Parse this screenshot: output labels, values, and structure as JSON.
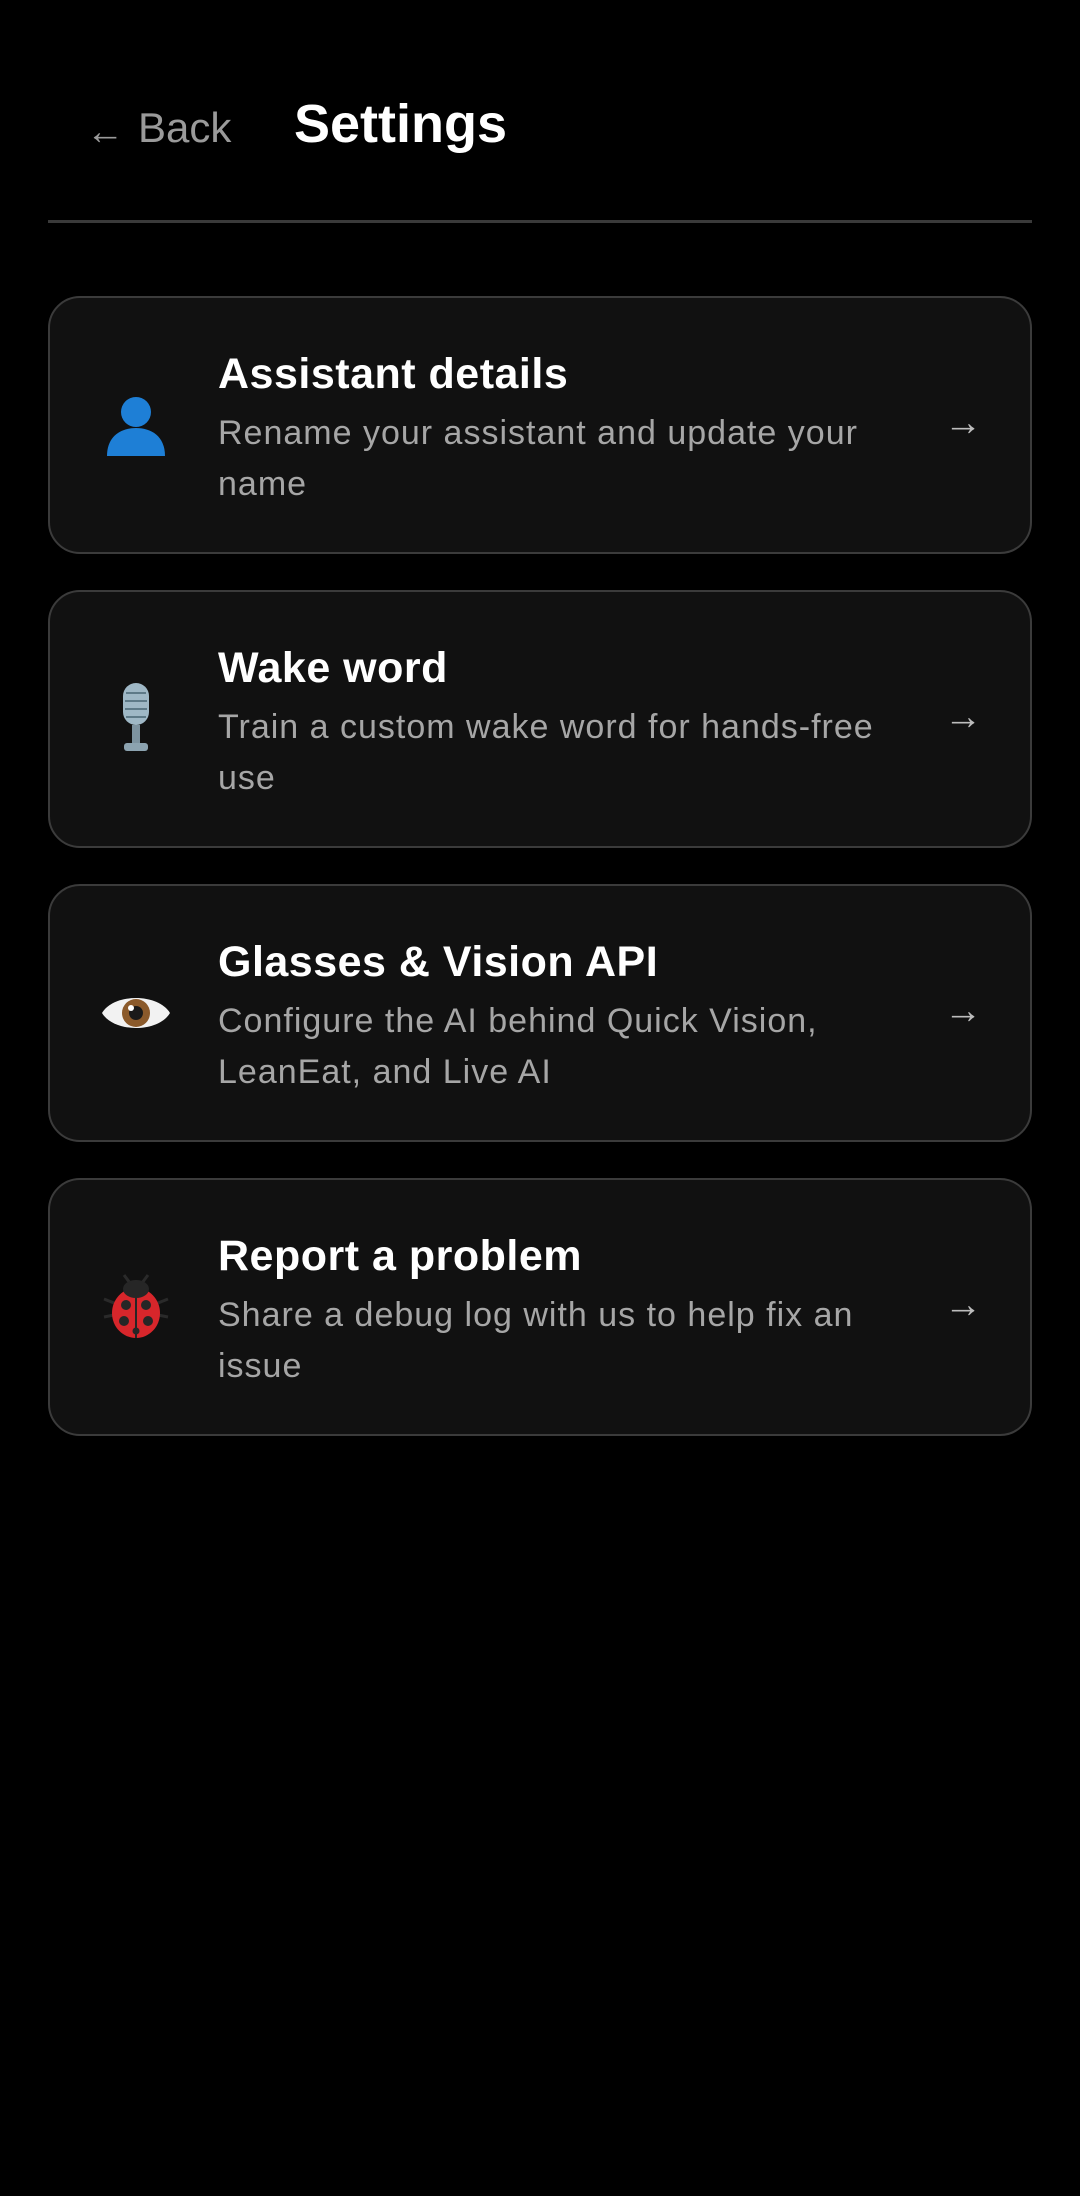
{
  "header": {
    "back_arrow": "←",
    "back_label": "Back",
    "title": "Settings"
  },
  "cards": [
    {
      "icon": "person-icon",
      "title": "Assistant details",
      "description": "Rename your assistant and update your name",
      "arrow": "→"
    },
    {
      "icon": "microphone-icon",
      "title": "Wake word",
      "description": "Train a custom wake word for hands-free use",
      "arrow": "→"
    },
    {
      "icon": "eye-icon",
      "title": "Glasses & Vision API",
      "description": "Configure the AI behind Quick Vision, LeanEat, and Live AI",
      "arrow": "→"
    },
    {
      "icon": "ladybug-icon",
      "title": "Report a problem",
      "description": "Share a debug log with us to help fix an issue",
      "arrow": "→"
    }
  ],
  "colors": {
    "background": "#000000",
    "card_background": "#111111",
    "card_border": "#3b3b3b",
    "title_text": "#ffffff",
    "secondary_text": "#a6a6a6",
    "back_text": "#9a9a9a",
    "person_icon": "#1e7fd6"
  }
}
